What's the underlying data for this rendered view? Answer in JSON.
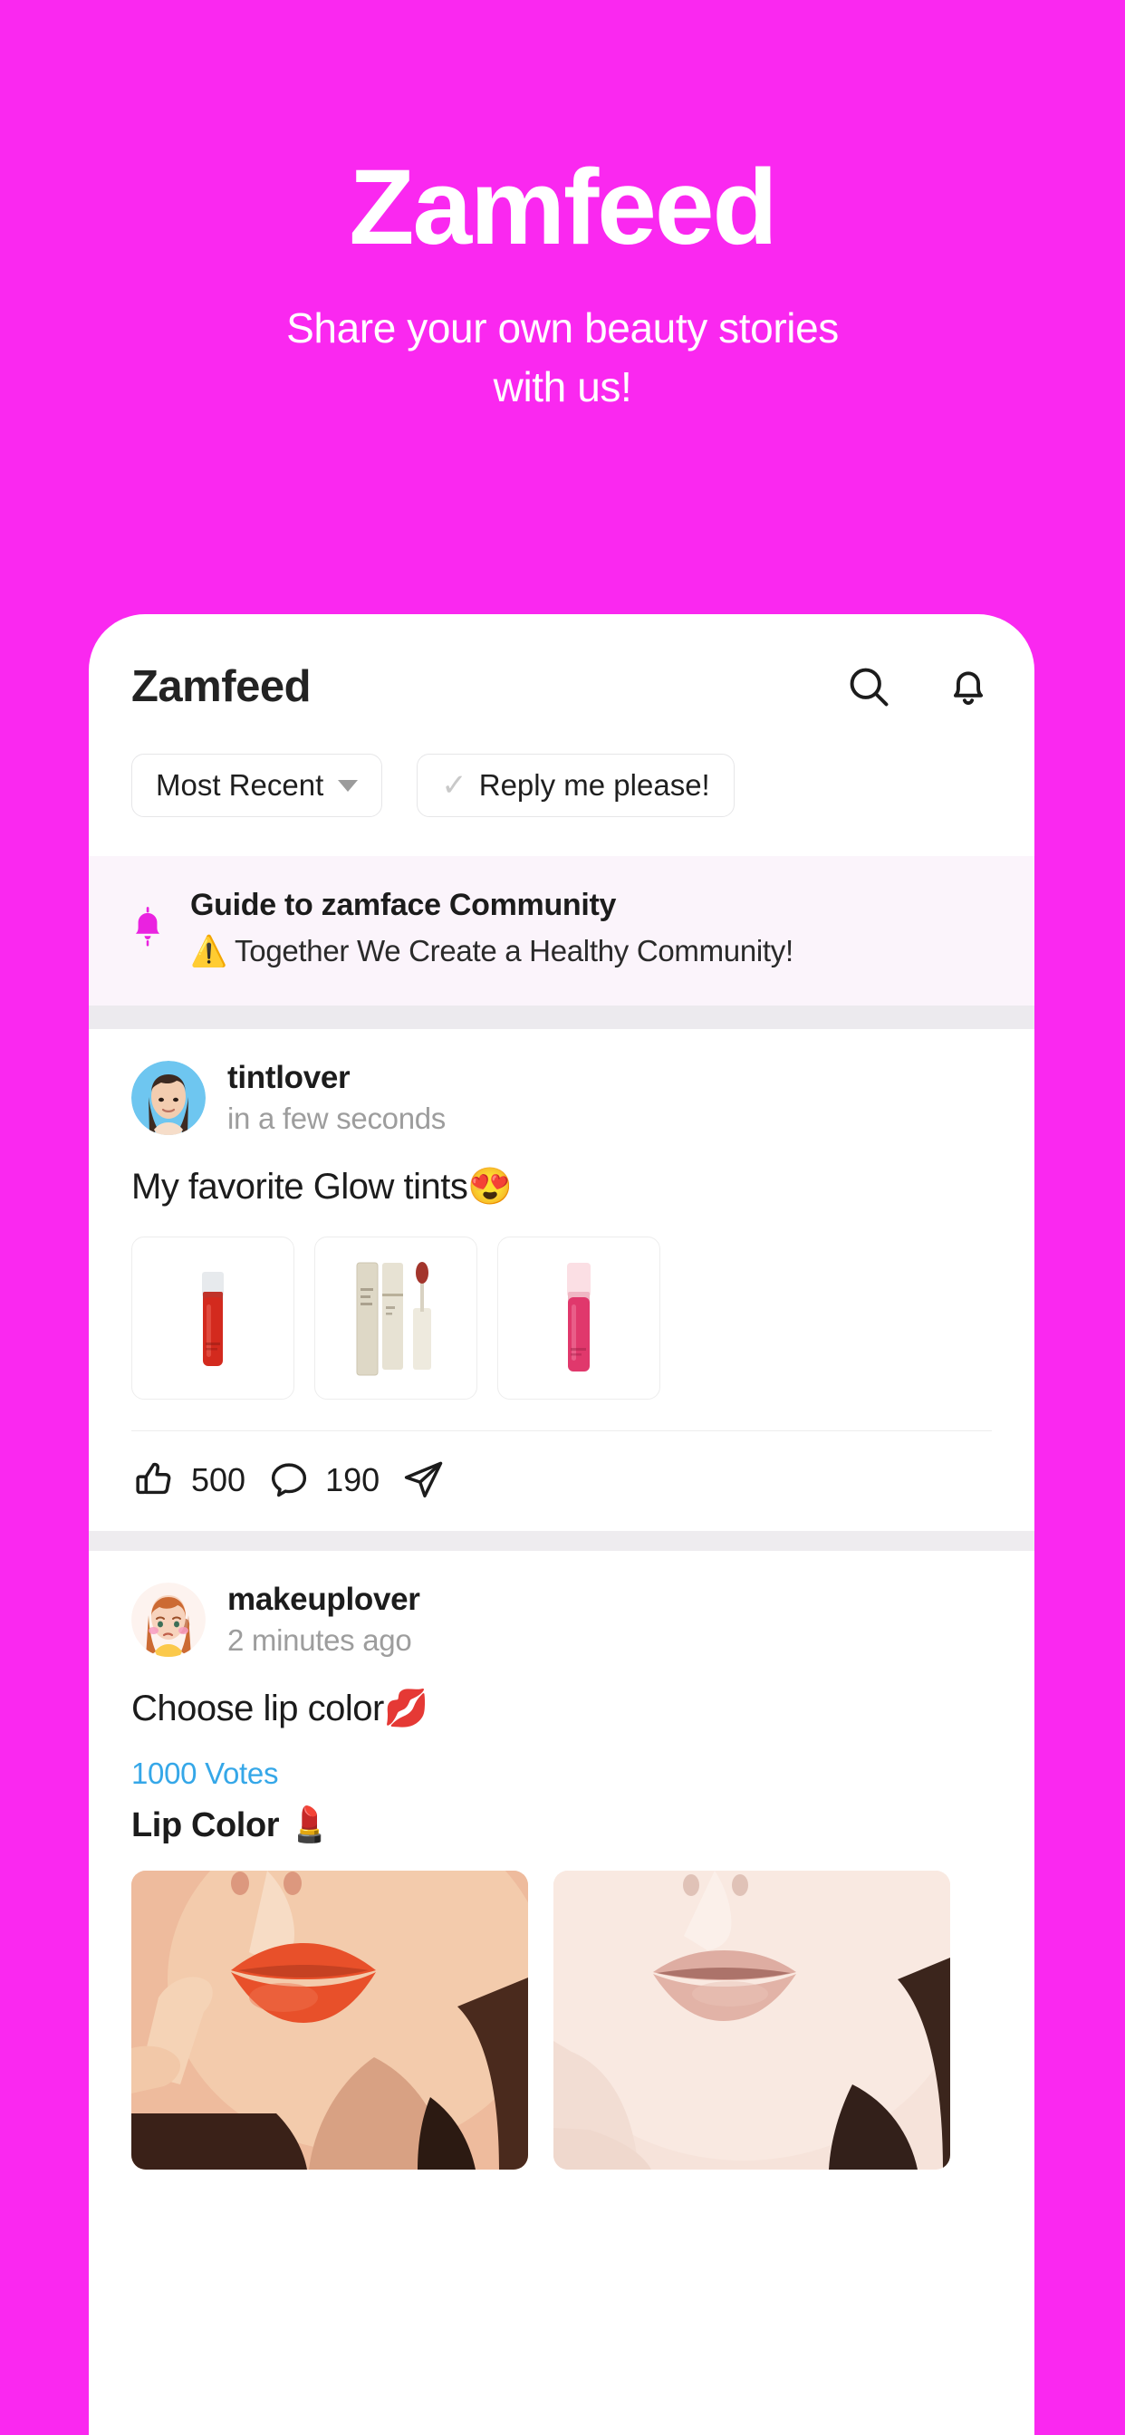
{
  "promo": {
    "title": "Zamfeed",
    "subtitle_line1": "Share your own beauty stories",
    "subtitle_line2": "with us!",
    "background_color": "#fa28f0"
  },
  "app": {
    "title": "Zamfeed",
    "icons": [
      {
        "name": "search-icon",
        "label": "Search"
      },
      {
        "name": "bell-icon",
        "label": "Notifications"
      }
    ]
  },
  "filters": [
    {
      "label": "Most Recent",
      "icon": "chevron-down-icon",
      "selected": true
    },
    {
      "label": "Reply me please!",
      "icon": "check-icon",
      "selected": false
    }
  ],
  "notice": {
    "icon": "bell-icon",
    "icon_color": "#ea22e0",
    "title": "Guide to zamface Community",
    "subtitle": "⚠️ Together We Create a Healthy Community!"
  },
  "posts": [
    {
      "username": "tintlover",
      "time": "in a few seconds",
      "avatar": "photo-avatar-woman",
      "text": "My favorite Glow tints😍",
      "thumbnails": [
        {
          "name": "lip-tint-red",
          "tube_color": "#d32a1e",
          "cap_color": "#e8e8ec"
        },
        {
          "name": "lip-tint-beige",
          "tube_color": "#ddd6c4",
          "cap_color": "#c9c2ac"
        },
        {
          "name": "lip-tint-pink",
          "tube_color": "#e0386c",
          "cap_color": "#f6d6dd"
        }
      ],
      "actions": [
        {
          "name": "like-button",
          "icon": "thumbs-up-icon",
          "count": "500"
        },
        {
          "name": "comment-button",
          "icon": "comment-icon",
          "count": "190"
        },
        {
          "name": "share-button",
          "icon": "send-icon",
          "count": ""
        }
      ]
    },
    {
      "username": "makeuplover",
      "time": "2 minutes ago",
      "avatar": "illustrated-avatar-girl",
      "text": "Choose lip color💋",
      "votes": "1000 Votes",
      "poll_title": "Lip Color 💄",
      "poll_options": [
        {
          "name": "poll-option-orange-lips",
          "lip_color": "#e8502a"
        },
        {
          "name": "poll-option-nude-lips",
          "lip_color": "#d9998e"
        }
      ]
    }
  ],
  "colors": {
    "accent": "#fa28f0",
    "votes_blue": "#35a7e8",
    "notice_bg": "#fbf4fb",
    "band": "#eceaee"
  }
}
